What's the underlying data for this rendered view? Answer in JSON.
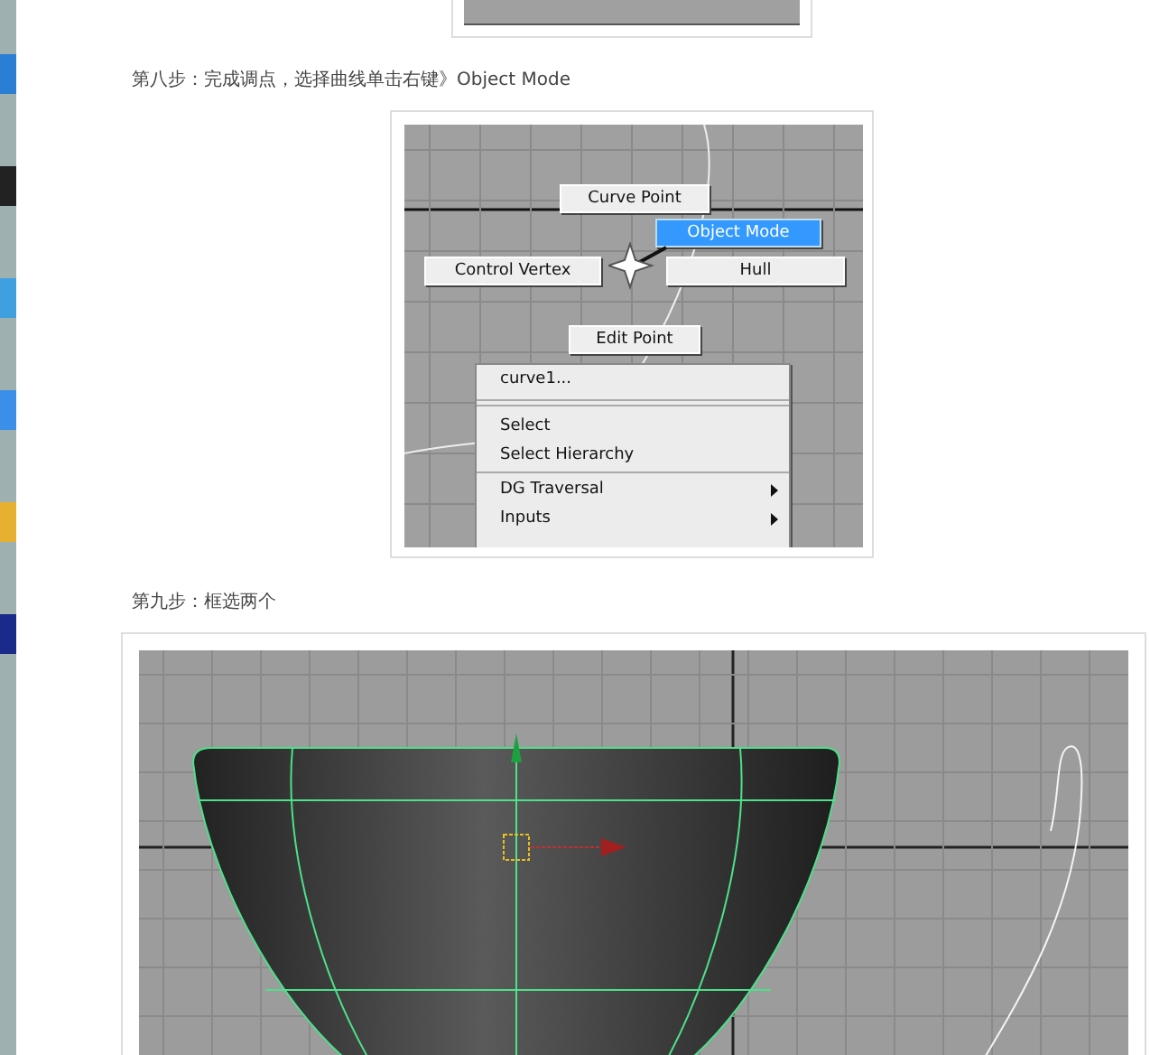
{
  "step_8": {
    "caption": "第八步：完成调点，选择曲线单击右键》Object Mode",
    "marking_menu": [
      {
        "label": "Curve Point",
        "selected": false
      },
      {
        "label": "Object Mode",
        "selected": true
      },
      {
        "label": "Control Vertex",
        "selected": false
      },
      {
        "label": "Hull",
        "selected": false
      },
      {
        "label": "Edit Point",
        "selected": false
      }
    ],
    "context_menu": [
      [
        {
          "label": "curve1...",
          "submenu": false
        }
      ],
      [
        {
          "label": "Select",
          "submenu": false
        },
        {
          "label": "Select Hierarchy",
          "submenu": false
        }
      ],
      [
        {
          "label": "DG Traversal",
          "submenu": true
        },
        {
          "label": "Inputs",
          "submenu": true
        }
      ]
    ]
  },
  "step_9": {
    "caption": "第九步：框选两个"
  }
}
